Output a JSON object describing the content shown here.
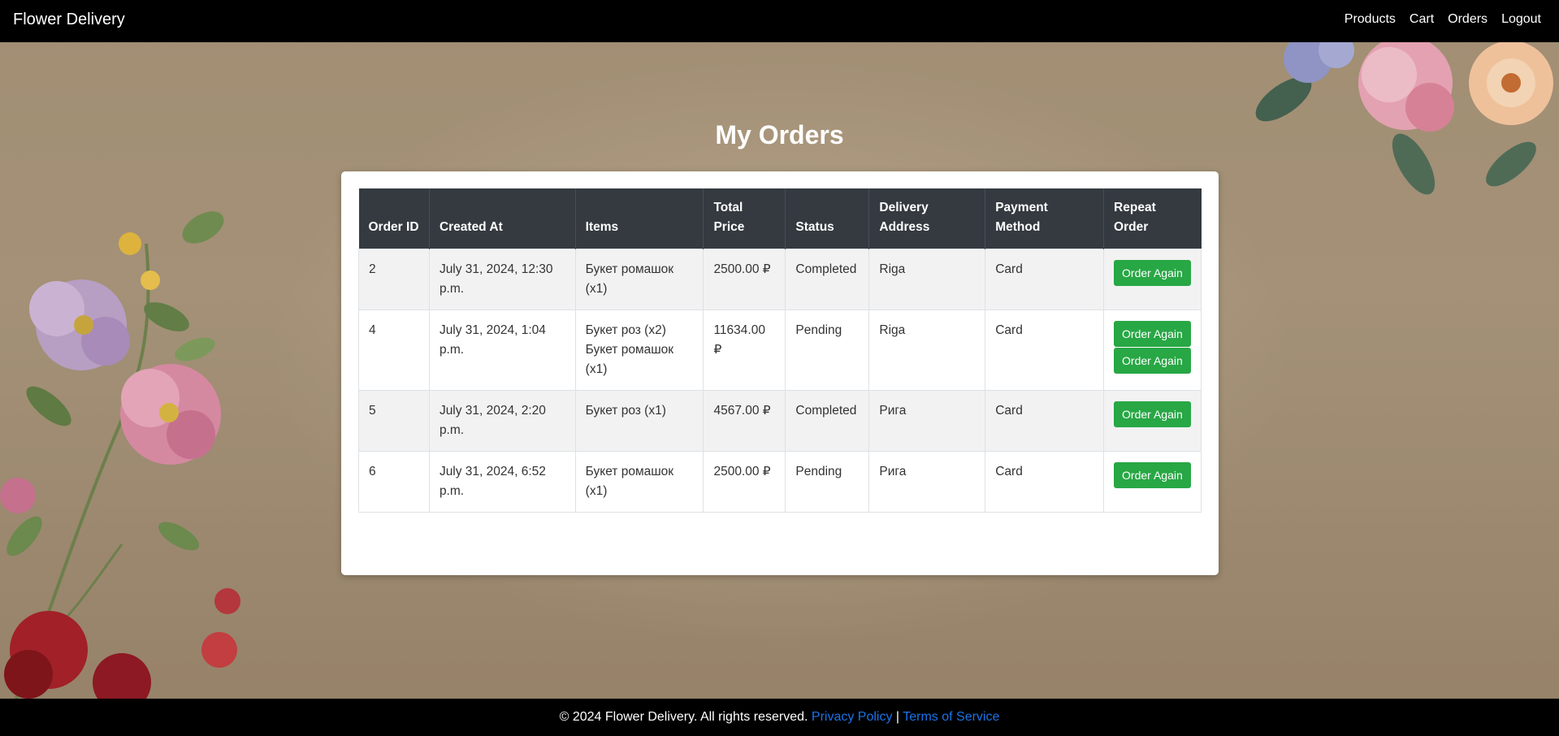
{
  "navbar": {
    "brand": "Flower Delivery",
    "links": [
      "Products",
      "Cart",
      "Orders",
      "Logout"
    ]
  },
  "main": {
    "title": "My Orders",
    "table": {
      "headers": [
        "Order ID",
        "Created At",
        "Items",
        "Total Price",
        "Status",
        "Delivery Address",
        "Payment Method",
        "Repeat Order"
      ],
      "rows": [
        {
          "order_id": "2",
          "created_at": "July 31, 2024, 12:30 p.m.",
          "items": [
            "Букет ромашок (x1)"
          ],
          "total_price": "2500.00 ₽",
          "status": "Completed",
          "delivery_address": "Riga",
          "payment_method": "Card",
          "repeat_buttons": [
            "Order Again"
          ]
        },
        {
          "order_id": "4",
          "created_at": "July 31, 2024, 1:04 p.m.",
          "items": [
            "Букет роз (x2)",
            "Букет ромашок (x1)"
          ],
          "total_price": "11634.00 ₽",
          "status": "Pending",
          "delivery_address": "Riga",
          "payment_method": "Card",
          "repeat_buttons": [
            "Order Again",
            "Order Again"
          ]
        },
        {
          "order_id": "5",
          "created_at": "July 31, 2024, 2:20 p.m.",
          "items": [
            "Букет роз (x1)"
          ],
          "total_price": "4567.00 ₽",
          "status": "Completed",
          "delivery_address": "Рига",
          "payment_method": "Card",
          "repeat_buttons": [
            "Order Again"
          ]
        },
        {
          "order_id": "6",
          "created_at": "July 31, 2024, 6:52 p.m.",
          "items": [
            "Букет ромашок (x1)"
          ],
          "total_price": "2500.00 ₽",
          "status": "Pending",
          "delivery_address": "Рига",
          "payment_method": "Card",
          "repeat_buttons": [
            "Order Again"
          ]
        }
      ]
    }
  },
  "footer": {
    "copyright": "© 2024 Flower Delivery. All rights reserved.",
    "privacy_link": "Privacy Policy",
    "separator": "|",
    "terms_link": "Terms of Service"
  },
  "colors": {
    "navbar_bg": "#000000",
    "table_header_bg": "#343a40",
    "button_green": "#28a745",
    "link_blue": "#1a73e8"
  }
}
